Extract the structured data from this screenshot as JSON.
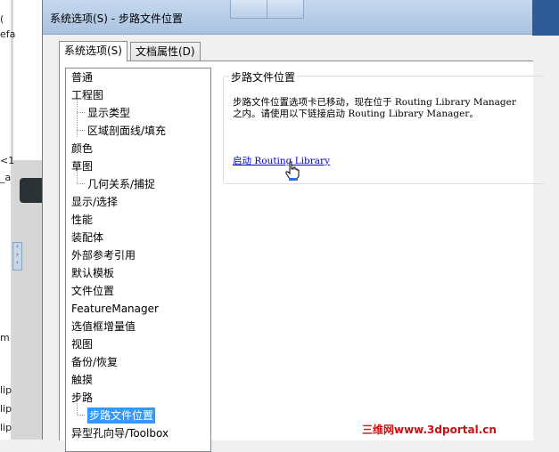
{
  "background_app": {
    "stubs": [
      "(",
      "efa",
      "<1",
      "_a",
      "m",
      "lip",
      "lip",
      "lip"
    ]
  },
  "dialog": {
    "title": "系统选项(S) - 步路文件位置",
    "tabs": [
      {
        "label": "系统选项(S)",
        "active": true
      },
      {
        "label": "文档属性(D)",
        "active": false
      }
    ]
  },
  "tree": {
    "items": [
      {
        "label": "普通",
        "level": 0
      },
      {
        "label": "工程图",
        "level": 0
      },
      {
        "label": "显示类型",
        "level": 1
      },
      {
        "label": "区域剖面线/填充",
        "level": 1
      },
      {
        "label": "颜色",
        "level": 0
      },
      {
        "label": "草图",
        "level": 0
      },
      {
        "label": "几何关系/捕捉",
        "level": 1
      },
      {
        "label": "显示/选择",
        "level": 0
      },
      {
        "label": "性能",
        "level": 0
      },
      {
        "label": "装配体",
        "level": 0
      },
      {
        "label": "外部参考引用",
        "level": 0
      },
      {
        "label": "默认模板",
        "level": 0
      },
      {
        "label": "文件位置",
        "level": 0
      },
      {
        "label": "FeatureManager",
        "level": 0
      },
      {
        "label": "选值框增量值",
        "level": 0
      },
      {
        "label": "视图",
        "level": 0
      },
      {
        "label": "备份/恢复",
        "level": 0
      },
      {
        "label": "触摸",
        "level": 0
      },
      {
        "label": "步路",
        "level": 0
      },
      {
        "label": "步路文件位置",
        "level": 1,
        "selected": true
      },
      {
        "label": "异型孔向导/Toolbox",
        "level": 0
      }
    ]
  },
  "content": {
    "group_title": "步路文件位置",
    "message_line1": "步路文件位置选项卡已移动，现在位于 Routing Library Manager",
    "message_line2": "之内。请使用以下链接启动 Routing Library Manager。",
    "link_label": "启动 Routing Library"
  },
  "watermark": "三维网www.3dportal.cn",
  "colors": {
    "selection": "#3399ff",
    "link": "#0000cc",
    "watermark": "#cc1111",
    "titlebar": "#b6cce8"
  }
}
